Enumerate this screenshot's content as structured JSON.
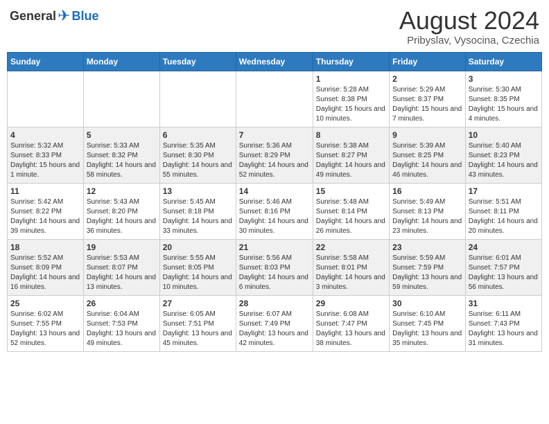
{
  "header": {
    "logo_general": "General",
    "logo_blue": "Blue",
    "month_title": "August 2024",
    "location": "Pribyslav, Vysocina, Czechia"
  },
  "weekdays": [
    "Sunday",
    "Monday",
    "Tuesday",
    "Wednesday",
    "Thursday",
    "Friday",
    "Saturday"
  ],
  "weeks": [
    [
      {
        "day": "",
        "info": ""
      },
      {
        "day": "",
        "info": ""
      },
      {
        "day": "",
        "info": ""
      },
      {
        "day": "",
        "info": ""
      },
      {
        "day": "1",
        "info": "Sunrise: 5:28 AM\nSunset: 8:38 PM\nDaylight: 15 hours and 10 minutes."
      },
      {
        "day": "2",
        "info": "Sunrise: 5:29 AM\nSunset: 8:37 PM\nDaylight: 15 hours and 7 minutes."
      },
      {
        "day": "3",
        "info": "Sunrise: 5:30 AM\nSunset: 8:35 PM\nDaylight: 15 hours and 4 minutes."
      }
    ],
    [
      {
        "day": "4",
        "info": "Sunrise: 5:32 AM\nSunset: 8:33 PM\nDaylight: 15 hours and 1 minute."
      },
      {
        "day": "5",
        "info": "Sunrise: 5:33 AM\nSunset: 8:32 PM\nDaylight: 14 hours and 58 minutes."
      },
      {
        "day": "6",
        "info": "Sunrise: 5:35 AM\nSunset: 8:30 PM\nDaylight: 14 hours and 55 minutes."
      },
      {
        "day": "7",
        "info": "Sunrise: 5:36 AM\nSunset: 8:29 PM\nDaylight: 14 hours and 52 minutes."
      },
      {
        "day": "8",
        "info": "Sunrise: 5:38 AM\nSunset: 8:27 PM\nDaylight: 14 hours and 49 minutes."
      },
      {
        "day": "9",
        "info": "Sunrise: 5:39 AM\nSunset: 8:25 PM\nDaylight: 14 hours and 46 minutes."
      },
      {
        "day": "10",
        "info": "Sunrise: 5:40 AM\nSunset: 8:23 PM\nDaylight: 14 hours and 43 minutes."
      }
    ],
    [
      {
        "day": "11",
        "info": "Sunrise: 5:42 AM\nSunset: 8:22 PM\nDaylight: 14 hours and 39 minutes."
      },
      {
        "day": "12",
        "info": "Sunrise: 5:43 AM\nSunset: 8:20 PM\nDaylight: 14 hours and 36 minutes."
      },
      {
        "day": "13",
        "info": "Sunrise: 5:45 AM\nSunset: 8:18 PM\nDaylight: 14 hours and 33 minutes."
      },
      {
        "day": "14",
        "info": "Sunrise: 5:46 AM\nSunset: 8:16 PM\nDaylight: 14 hours and 30 minutes."
      },
      {
        "day": "15",
        "info": "Sunrise: 5:48 AM\nSunset: 8:14 PM\nDaylight: 14 hours and 26 minutes."
      },
      {
        "day": "16",
        "info": "Sunrise: 5:49 AM\nSunset: 8:13 PM\nDaylight: 14 hours and 23 minutes."
      },
      {
        "day": "17",
        "info": "Sunrise: 5:51 AM\nSunset: 8:11 PM\nDaylight: 14 hours and 20 minutes."
      }
    ],
    [
      {
        "day": "18",
        "info": "Sunrise: 5:52 AM\nSunset: 8:09 PM\nDaylight: 14 hours and 16 minutes."
      },
      {
        "day": "19",
        "info": "Sunrise: 5:53 AM\nSunset: 8:07 PM\nDaylight: 14 hours and 13 minutes."
      },
      {
        "day": "20",
        "info": "Sunrise: 5:55 AM\nSunset: 8:05 PM\nDaylight: 14 hours and 10 minutes."
      },
      {
        "day": "21",
        "info": "Sunrise: 5:56 AM\nSunset: 8:03 PM\nDaylight: 14 hours and 6 minutes."
      },
      {
        "day": "22",
        "info": "Sunrise: 5:58 AM\nSunset: 8:01 PM\nDaylight: 14 hours and 3 minutes."
      },
      {
        "day": "23",
        "info": "Sunrise: 5:59 AM\nSunset: 7:59 PM\nDaylight: 13 hours and 59 minutes."
      },
      {
        "day": "24",
        "info": "Sunrise: 6:01 AM\nSunset: 7:57 PM\nDaylight: 13 hours and 56 minutes."
      }
    ],
    [
      {
        "day": "25",
        "info": "Sunrise: 6:02 AM\nSunset: 7:55 PM\nDaylight: 13 hours and 52 minutes."
      },
      {
        "day": "26",
        "info": "Sunrise: 6:04 AM\nSunset: 7:53 PM\nDaylight: 13 hours and 49 minutes."
      },
      {
        "day": "27",
        "info": "Sunrise: 6:05 AM\nSunset: 7:51 PM\nDaylight: 13 hours and 45 minutes."
      },
      {
        "day": "28",
        "info": "Sunrise: 6:07 AM\nSunset: 7:49 PM\nDaylight: 13 hours and 42 minutes."
      },
      {
        "day": "29",
        "info": "Sunrise: 6:08 AM\nSunset: 7:47 PM\nDaylight: 13 hours and 38 minutes."
      },
      {
        "day": "30",
        "info": "Sunrise: 6:10 AM\nSunset: 7:45 PM\nDaylight: 13 hours and 35 minutes."
      },
      {
        "day": "31",
        "info": "Sunrise: 6:11 AM\nSunset: 7:43 PM\nDaylight: 13 hours and 31 minutes."
      }
    ]
  ]
}
